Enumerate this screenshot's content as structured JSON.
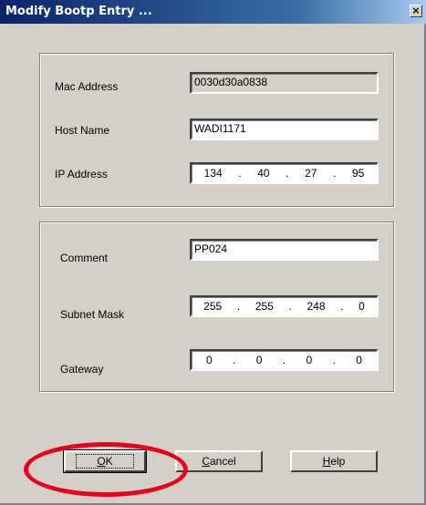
{
  "window": {
    "title": "Modify Bootp Entry ...",
    "close_glyph": "×"
  },
  "fields": {
    "mac": {
      "label": "Mac Address",
      "value": "0030d30a0838"
    },
    "host": {
      "label": "Host Name",
      "value": "WADI1171"
    },
    "ip": {
      "label": "IP Address",
      "octets": [
        "134",
        "40",
        "27",
        "95"
      ]
    },
    "comment": {
      "label": "Comment",
      "value": "PP024"
    },
    "subnet": {
      "label": "Subnet Mask",
      "octets": [
        "255",
        "255",
        "248",
        "0"
      ]
    },
    "gateway": {
      "label": "Gateway",
      "octets": [
        "0",
        "0",
        "0",
        "0"
      ]
    }
  },
  "buttons": {
    "ok": {
      "label_u": "O",
      "label_rest": "K"
    },
    "cancel": {
      "label_u": "C",
      "label_rest": "ancel"
    },
    "help": {
      "label_u": "H",
      "label_rest": "elp"
    }
  },
  "colors": {
    "highlight": "#e8001c",
    "titlebar": "#0a246a",
    "face": "#d4d0c8"
  },
  "icons": {
    "close": "close-icon"
  }
}
